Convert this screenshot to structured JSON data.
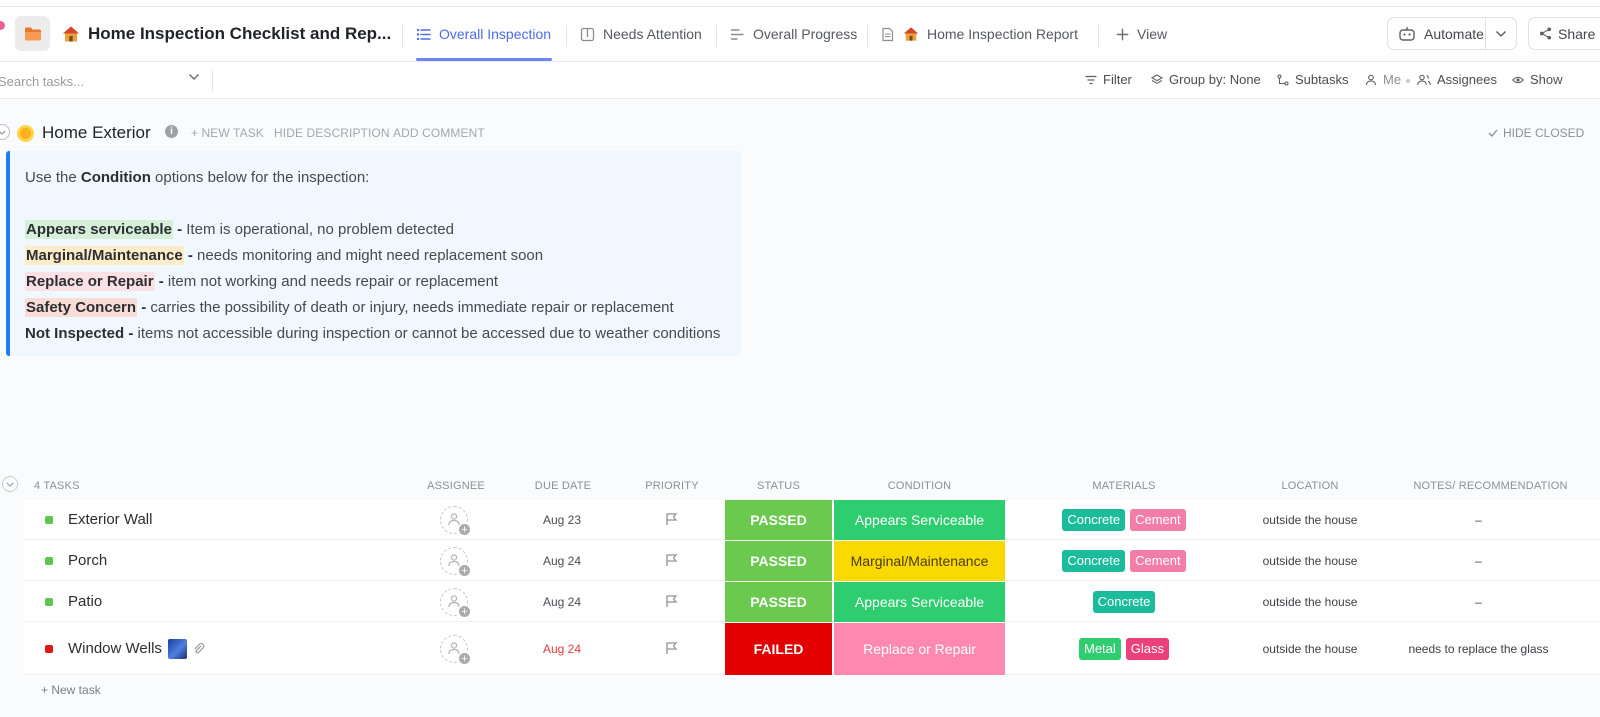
{
  "header": {
    "title": "Home Inspection Checklist and Rep...",
    "tabs": [
      {
        "label": "Overall Inspection",
        "icon": "list-icon",
        "active": true
      },
      {
        "label": "Needs Attention",
        "icon": "board-icon",
        "active": false
      },
      {
        "label": "Overall Progress",
        "icon": "gantt-icon",
        "active": false
      },
      {
        "label": "Home Inspection Report",
        "icon": "doc-icon",
        "active": false
      }
    ],
    "view_label": "View",
    "automate_label": "Automate",
    "share_label": "Share"
  },
  "toolbar": {
    "search_placeholder": "Search tasks...",
    "filter_label": "Filter",
    "group_by_label": "Group by: None",
    "subtasks_label": "Subtasks",
    "me_label": "Me",
    "assignees_label": "Assignees",
    "show_label": "Show"
  },
  "group": {
    "title": "Home Exterior",
    "new_task_label": "+ NEW TASK",
    "hide_description_label": "HIDE DESCRIPTION",
    "add_comment_label": "ADD COMMENT",
    "hide_closed_label": "HIDE CLOSED"
  },
  "description": {
    "intro_prefix": "Use the ",
    "intro_bold": "Condition",
    "intro_suffix": " options below for the inspection:",
    "items": [
      {
        "term": "Appears serviceable",
        "sep": " - ",
        "text": "Item is operational, no problem detected",
        "highlight": "#d5efd9"
      },
      {
        "term": "Marginal/Maintenance",
        "sep": " - ",
        "text": "needs monitoring and might need replacement soon",
        "highlight": "#fdecc8"
      },
      {
        "term": "Replace or Repair",
        "sep": " - ",
        "text": "item not working and needs repair or replacement",
        "highlight": "#fbe0e6"
      },
      {
        "term": "Safety Concern",
        "sep": " - ",
        "text": "carries the possibility of death or injury, needs immediate repair or replacement",
        "highlight": "#f9dcd6"
      },
      {
        "term": "Not Inspected",
        "sep": " - ",
        "text": "items not accessible during inspection or cannot be accessed due to weather conditions",
        "highlight": ""
      }
    ]
  },
  "table": {
    "count_label": "4 TASKS",
    "columns": {
      "assignee": "ASSIGNEE",
      "due_date": "DUE DATE",
      "priority": "PRIORITY",
      "status": "STATUS",
      "condition": "CONDITION",
      "materials": "MATERIALS",
      "location": "LOCATION",
      "notes": "NOTES/ RECOMMENDATION"
    },
    "rows": [
      {
        "name": "Exterior Wall",
        "dot_color": "#5ec64f",
        "due": "Aug 23",
        "due_color": "#4a4d53",
        "status": "PASSED",
        "status_color": "#6bc950",
        "condition": "Appears Serviceable",
        "condition_color": "#2ecd6f",
        "condition_text_color": "#ffffff",
        "materials": [
          {
            "label": "Concrete",
            "color": "#1bbc9c"
          },
          {
            "label": "Cement",
            "color": "#f27ea8"
          }
        ],
        "location": "outside the house",
        "notes": "–"
      },
      {
        "name": "Porch",
        "dot_color": "#5ec64f",
        "due": "Aug 24",
        "due_color": "#4a4d53",
        "status": "PASSED",
        "status_color": "#6bc950",
        "condition": "Marginal/Maintenance",
        "condition_color": "#f9d900",
        "condition_text_color": "#4a3d00",
        "materials": [
          {
            "label": "Concrete",
            "color": "#1bbc9c"
          },
          {
            "label": "Cement",
            "color": "#f27ea8"
          }
        ],
        "location": "outside the house",
        "notes": "–"
      },
      {
        "name": "Patio",
        "dot_color": "#5ec64f",
        "due": "Aug 24",
        "due_color": "#4a4d53",
        "status": "PASSED",
        "status_color": "#6bc950",
        "condition": "Appears Serviceable",
        "condition_color": "#2ecd6f",
        "condition_text_color": "#ffffff",
        "materials": [
          {
            "label": "Concrete",
            "color": "#1bbc9c"
          }
        ],
        "location": "outside the house",
        "notes": "–"
      },
      {
        "name": "Window Wells",
        "dot_color": "#e11717",
        "due": "Aug 24",
        "due_color": "#e0393e",
        "status": "FAILED",
        "status_color": "#e20000",
        "condition": "Replace or Repair",
        "condition_color": "#ff88b0",
        "condition_text_color": "#ffffff",
        "materials": [
          {
            "label": "Metal",
            "color": "#2ecd6f"
          },
          {
            "label": "Glass",
            "color": "#ec407a"
          }
        ],
        "location": "outside the house",
        "notes": "needs to replace the glass"
      }
    ],
    "new_task_label": "+ New task"
  }
}
